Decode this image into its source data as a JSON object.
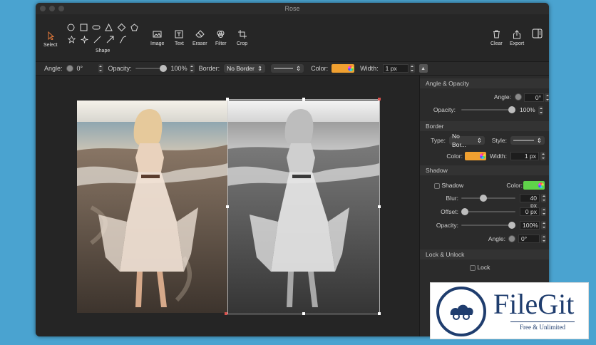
{
  "window": {
    "title": "Rose"
  },
  "toolbar": {
    "select": "Select",
    "shape": "Shape",
    "image": "Image",
    "text": "Text",
    "eraser": "Eraser",
    "filter": "Filter",
    "crop": "Crop",
    "clear": "Clear",
    "export": "Export"
  },
  "options": {
    "angle_label": "Angle:",
    "angle_value": "0°",
    "opacity_label": "Opacity:",
    "opacity_value": "100%",
    "opacity_level": 1.0,
    "border_label": "Border:",
    "border_value": "No Border",
    "color_label": "Color:",
    "color": "#f0a030",
    "width_label": "Width:",
    "width_value": "1 px"
  },
  "sidebar": {
    "angle_opacity": {
      "title": "Angle & Opacity",
      "angle_label": "Angle:",
      "angle_value": "0°",
      "opacity_label": "Opacity:",
      "opacity_value": "100%",
      "opacity_level": 1.0
    },
    "border": {
      "title": "Border",
      "type_label": "Type:",
      "type_value": "No Bor...",
      "style_label": "Style:",
      "color_label": "Color:",
      "color": "#f0a030",
      "width_label": "Width:",
      "width_value": "1 px"
    },
    "shadow": {
      "title": "Shadow",
      "shadow_label": "Shadow",
      "color_label": "Color:",
      "color": "#5fd24a",
      "blur_label": "Blur:",
      "blur_value": "40 px",
      "blur_level": 0.4,
      "offset_label": "Offset:",
      "offset_value": "0 px",
      "offset_level": 0.0,
      "opacity_label": "Opacity:",
      "opacity_value": "100%",
      "opacity_level": 1.0,
      "angle_label": "Angle:",
      "angle_value": "0°"
    },
    "lock": {
      "title": "Lock & Unlock",
      "lock_label": "Lock"
    }
  },
  "watermark": {
    "brand": "FileGit",
    "tagline": "Free & Unlimited"
  }
}
